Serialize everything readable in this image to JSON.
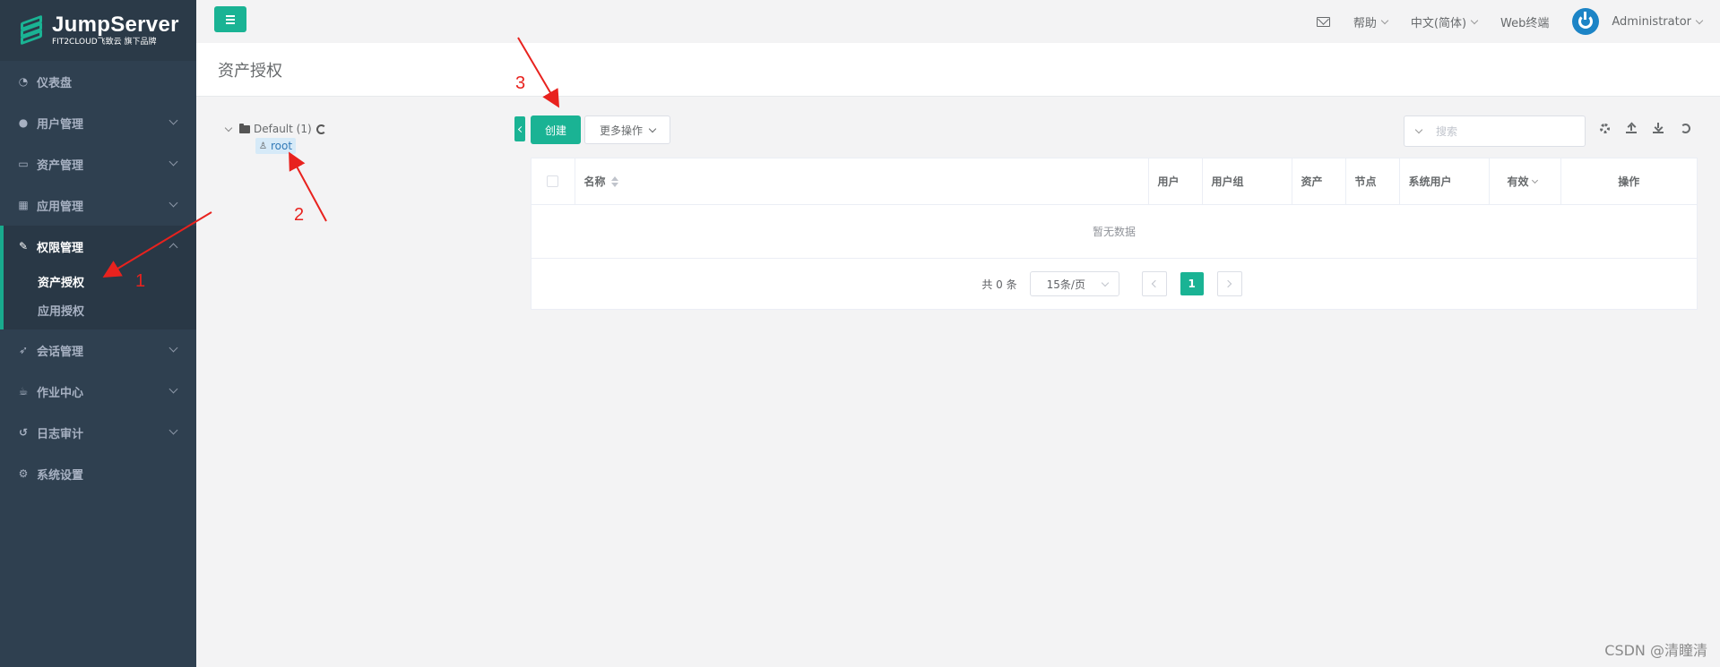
{
  "brand": {
    "name": "JumpServer",
    "tagline": "FIT2CLOUD飞致云 旗下品牌"
  },
  "sidebar": {
    "items": [
      {
        "label": "仪表盘",
        "icon": "dashboard-icon"
      },
      {
        "label": "用户管理",
        "icon": "users-icon"
      },
      {
        "label": "资产管理",
        "icon": "inbox-icon"
      },
      {
        "label": "应用管理",
        "icon": "grid-icon"
      }
    ],
    "active_group": {
      "label": "权限管理",
      "icon": "edit-icon",
      "children": [
        {
          "label": "资产授权",
          "active": true
        },
        {
          "label": "应用授权",
          "active": false
        }
      ]
    },
    "items_after": [
      {
        "label": "会话管理",
        "icon": "rocket-icon"
      },
      {
        "label": "作业中心",
        "icon": "coffee-icon"
      },
      {
        "label": "日志审计",
        "icon": "history-icon"
      },
      {
        "label": "系统设置",
        "icon": "gears-icon"
      }
    ]
  },
  "topbar": {
    "help": "帮助",
    "language": "中文(简体)",
    "web_terminal": "Web终端",
    "user": "Administrator"
  },
  "page": {
    "title": "资产授权"
  },
  "tree": {
    "root": "Default (1)",
    "child": "root"
  },
  "toolbar": {
    "create": "创建",
    "more_actions": "更多操作",
    "search_placeholder": "搜索"
  },
  "table": {
    "columns": [
      "名称",
      "用户",
      "用户组",
      "资产",
      "节点",
      "系统用户",
      "有效",
      "操作"
    ],
    "empty_text": "暂无数据"
  },
  "pagination": {
    "total": "共 0 条",
    "page_size": "15条/页",
    "current_page": "1"
  },
  "annotations": {
    "one": "1",
    "two": "2",
    "three": "3",
    "color": "#e8221e"
  },
  "watermark": "CSDN @清瞳清",
  "colors": {
    "accent": "#1ab394",
    "sidebar": "#2f4050"
  }
}
